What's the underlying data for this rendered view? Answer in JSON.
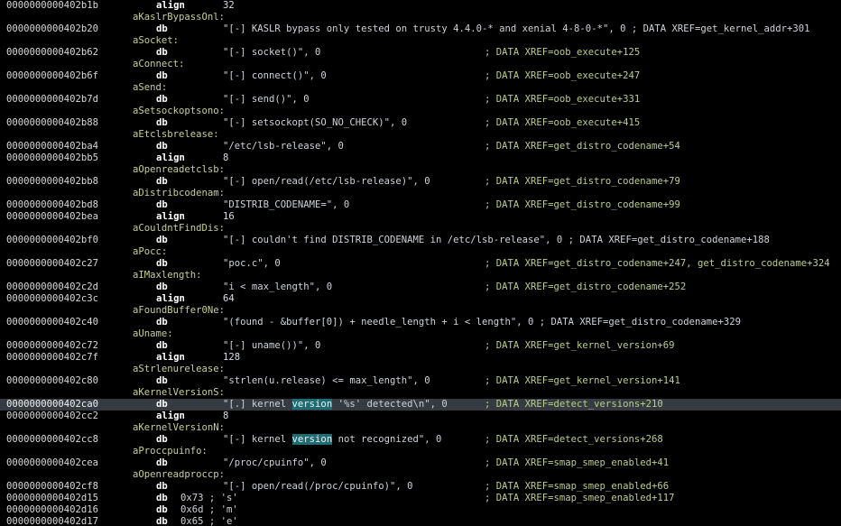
{
  "lines": [
    {
      "kind": "ins",
      "addr": "0000000000402b1b",
      "mn": "align",
      "arg": "32"
    },
    {
      "kind": "label",
      "text": "aKaslrBypassOnl:"
    },
    {
      "kind": "ins",
      "addr": "0000000000402b20",
      "mn": "db",
      "arg": "\"[-] KASLR bypass only tested on trusty 4.4.0-* and xenial 4-8-0-*\", 0 ; DATA XREF=get_kernel_addr+301"
    },
    {
      "kind": "label",
      "text": "aSocket:"
    },
    {
      "kind": "ins",
      "addr": "0000000000402b62",
      "mn": "db",
      "arg": "\"[-] socket()\", 0",
      "xref": "; DATA XREF=oob_execute+125"
    },
    {
      "kind": "label",
      "text": "aConnect:"
    },
    {
      "kind": "ins",
      "addr": "0000000000402b6f",
      "mn": "db",
      "arg": "\"[-] connect()\", 0",
      "xref": "; DATA XREF=oob_execute+247"
    },
    {
      "kind": "label",
      "text": "aSend:"
    },
    {
      "kind": "ins",
      "addr": "0000000000402b7d",
      "mn": "db",
      "arg": "\"[-] send()\", 0",
      "xref": "; DATA XREF=oob_execute+331"
    },
    {
      "kind": "label",
      "text": "aSetsockoptsono:"
    },
    {
      "kind": "ins",
      "addr": "0000000000402b88",
      "mn": "db",
      "arg": "\"[-] setsockopt(SO_NO_CHECK)\", 0",
      "xref": "; DATA XREF=oob_execute+415"
    },
    {
      "kind": "label",
      "text": "aEtclsbrelease:"
    },
    {
      "kind": "ins",
      "addr": "0000000000402ba4",
      "mn": "db",
      "arg": "\"/etc/lsb-release\", 0",
      "xref": "; DATA XREF=get_distro_codename+54"
    },
    {
      "kind": "ins",
      "addr": "0000000000402bb5",
      "mn": "align",
      "arg": "8"
    },
    {
      "kind": "label",
      "text": "aOpenreadetclsb:"
    },
    {
      "kind": "ins",
      "addr": "0000000000402bb8",
      "mn": "db",
      "arg": "\"[-] open/read(/etc/lsb-release)\", 0",
      "xref": "; DATA XREF=get_distro_codename+79"
    },
    {
      "kind": "label",
      "text": "aDistribcodenam:"
    },
    {
      "kind": "ins",
      "addr": "0000000000402bd8",
      "mn": "db",
      "arg": "\"DISTRIB_CODENAME=\", 0",
      "xref": "; DATA XREF=get_distro_codename+99"
    },
    {
      "kind": "ins",
      "addr": "0000000000402bea",
      "mn": "align",
      "arg": "16"
    },
    {
      "kind": "label",
      "text": "aCouldntFindDis:"
    },
    {
      "kind": "ins",
      "addr": "0000000000402bf0",
      "mn": "db",
      "arg": "\"[-] couldn't find DISTRIB_CODENAME in /etc/lsb-release\", 0 ; DATA XREF=get_distro_codename+188"
    },
    {
      "kind": "label",
      "text": "aPocc:"
    },
    {
      "kind": "ins",
      "addr": "0000000000402c27",
      "mn": "db",
      "arg": "\"poc.c\", 0",
      "xref": "; DATA XREF=get_distro_codename+247, get_distro_codename+324"
    },
    {
      "kind": "label",
      "text": "aIMaxlength:"
    },
    {
      "kind": "ins",
      "addr": "0000000000402c2d",
      "mn": "db",
      "arg": "\"i < max_length\", 0",
      "xref": "; DATA XREF=get_distro_codename+252"
    },
    {
      "kind": "ins",
      "addr": "0000000000402c3c",
      "mn": "align",
      "arg": "64"
    },
    {
      "kind": "label",
      "text": "aFoundBuffer0Ne:"
    },
    {
      "kind": "ins",
      "addr": "0000000000402c40",
      "mn": "db",
      "arg": "\"(found - &buffer[0]) + needle_length + i < length\", 0 ; DATA XREF=get_distro_codename+329"
    },
    {
      "kind": "label",
      "text": "aUname:"
    },
    {
      "kind": "ins",
      "addr": "0000000000402c72",
      "mn": "db",
      "arg": "\"[-] uname())\", 0",
      "xref": "; DATA XREF=get_kernel_version+69"
    },
    {
      "kind": "ins",
      "addr": "0000000000402c7f",
      "mn": "align",
      "arg": "128"
    },
    {
      "kind": "label",
      "text": "aStrlenurelease:"
    },
    {
      "kind": "ins",
      "addr": "0000000000402c80",
      "mn": "db",
      "arg": "\"strlen(u.release) <= max_length\", 0",
      "xref": "; DATA XREF=get_kernel_version+141"
    },
    {
      "kind": "label",
      "text": "aKernelVersionS:"
    },
    {
      "kind": "ins",
      "addr": "0000000000402ca0",
      "mn": "db",
      "arg_pre": "\"[.] kernel ",
      "arg_hl": "version",
      "arg_post": " '%s' detected\\n\", 0",
      "xref": "; DATA XREF=detect_versions+210",
      "selected": true
    },
    {
      "kind": "ins",
      "addr": "0000000000402cc2",
      "mn": "align",
      "arg": "8"
    },
    {
      "kind": "label",
      "text": "aKernelVersionN:"
    },
    {
      "kind": "ins",
      "addr": "0000000000402cc8",
      "mn": "db",
      "arg_pre": "\"[-] kernel ",
      "arg_hl": "version",
      "arg_post": " not recognized\", 0",
      "xref": "; DATA XREF=detect_versions+268"
    },
    {
      "kind": "label",
      "text": "aProccpuinfo:"
    },
    {
      "kind": "ins",
      "addr": "0000000000402cea",
      "mn": "db",
      "arg": "\"/proc/cpuinfo\", 0",
      "xref": "; DATA XREF=smap_smep_enabled+41"
    },
    {
      "kind": "label",
      "text": "aOpenreadproccp:"
    },
    {
      "kind": "ins",
      "addr": "0000000000402cf8",
      "mn": "db",
      "arg": "\"[-] open/read(/proc/cpuinfo)\", 0",
      "xref": "; DATA XREF=smap_smep_enabled+66"
    },
    {
      "kind": "byte",
      "addr": "0000000000402d15",
      "mn": "db",
      "arg": "0x73 ; 's'",
      "xref": "; DATA XREF=smap_smep_enabled+117"
    },
    {
      "kind": "byte",
      "addr": "0000000000402d16",
      "mn": "db",
      "arg": "0x6d ; 'm'"
    },
    {
      "kind": "byte",
      "addr": "0000000000402d17",
      "mn": "db",
      "arg": "0x65 ; 'e'"
    }
  ]
}
